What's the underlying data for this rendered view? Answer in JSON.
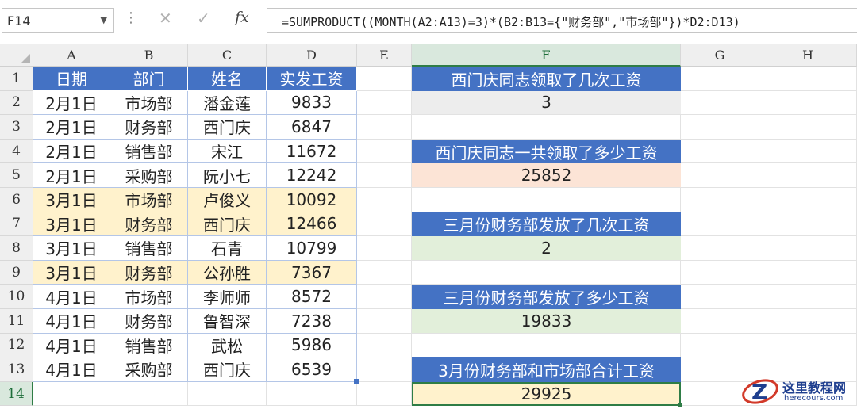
{
  "formula_bar": {
    "name_box": "F14",
    "formula": "=SUMPRODUCT((MONTH(A2:A13)=3)*(B2:B13={\"财务部\",\"市场部\"})*D2:D13)",
    "fx_label": "fx"
  },
  "columns": [
    "A",
    "B",
    "C",
    "D",
    "E",
    "F",
    "G",
    "H"
  ],
  "rows": [
    "1",
    "2",
    "3",
    "4",
    "5",
    "6",
    "7",
    "8",
    "9",
    "10",
    "11",
    "12",
    "13",
    "14"
  ],
  "table": {
    "headers": [
      "日期",
      "部门",
      "姓名",
      "实发工资"
    ],
    "rows": [
      [
        "2月1日",
        "市场部",
        "潘金莲",
        "9833"
      ],
      [
        "2月1日",
        "财务部",
        "西门庆",
        "6847"
      ],
      [
        "2月1日",
        "销售部",
        "宋江",
        "11672"
      ],
      [
        "2月1日",
        "采购部",
        "阮小七",
        "12242"
      ],
      [
        "3月1日",
        "市场部",
        "卢俊义",
        "10092"
      ],
      [
        "3月1日",
        "财务部",
        "西门庆",
        "12466"
      ],
      [
        "3月1日",
        "销售部",
        "石青",
        "10799"
      ],
      [
        "3月1日",
        "财务部",
        "公孙胜",
        "7367"
      ],
      [
        "4月1日",
        "市场部",
        "李师师",
        "8572"
      ],
      [
        "4月1日",
        "财务部",
        "鲁智深",
        "7238"
      ],
      [
        "4月1日",
        "销售部",
        "武松",
        "5986"
      ],
      [
        "4月1日",
        "采购部",
        "西门庆",
        "6539"
      ]
    ]
  },
  "questions": [
    {
      "question": "西门庆同志领取了几次工资",
      "answer": "3"
    },
    {
      "question": "西门庆同志一共领取了多少工资",
      "answer": "25852"
    },
    {
      "question": "三月份财务部发放了几次工资",
      "answer": "2"
    },
    {
      "question": "三月份财务部发放了多少工资",
      "answer": "19833"
    },
    {
      "question": "3月份财务部和市场部合计工资",
      "answer": "29925"
    }
  ],
  "watermark": {
    "title": "这里教程网",
    "url": "herecours.com"
  },
  "colors": {
    "header_blue": "#4472c4",
    "highlight_yellow": "#fff2cc",
    "answer_gray": "#ededed",
    "answer_pink": "#fce4d6",
    "answer_green": "#e2efda",
    "selection_green": "#2f7d46"
  }
}
